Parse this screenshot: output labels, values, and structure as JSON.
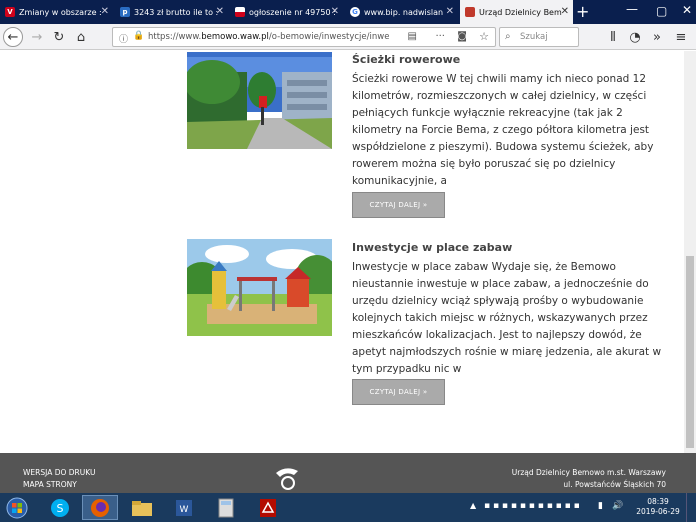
{
  "tabs": [
    {
      "title": "Zmiany w obszarze :",
      "fav": "V",
      "favcolor": "#d0021b"
    },
    {
      "title": "3243 zł brutto ile to :",
      "fav": "p",
      "favcolor": "#2a6cc2"
    },
    {
      "title": "ogłoszenie nr 49750 :",
      "fav": "",
      "favcolor": "#d0021b"
    },
    {
      "title": "www.bip. nadwislan",
      "fav": "G",
      "favcolor": "#ffffff"
    },
    {
      "title": "Urząd Dzielnicy Bem",
      "fav": "",
      "favcolor": "#c0392b"
    }
  ],
  "address": {
    "prefix": "https://www.",
    "domain": "bemowo.waw.pl",
    "path": "/o-bemowie/inwestycje/inwe"
  },
  "search_placeholder": "Szukaj",
  "articles": [
    {
      "title": "Ścieżki rowerowe",
      "text": "Ścieżki rowerowe W tej chwili mamy ich nieco ponad 12 kilometrów, rozmieszczonych w całej dzielnicy, w części pełniących funkcje wyłącznie rekreacyjne (tak jak 2 kilometry na Forcie Bema, z czego półtora kilometra jest współdzielone z pieszymi). Budowa systemu ścieżek, aby rowerem można się było poruszać się po dzielnicy komunikacyjnie, a",
      "button": "CZYTAJ DALEJ »"
    },
    {
      "title": "Inwestycje w place zabaw",
      "text": "Inwestycje w place zabaw Wydaje się, że Bemowo nieustannie inwestuje w place zabaw, a jednocześnie do urzędu dzielnicy wciąż spływają prośby o wybudowanie kolejnych takich miejsc w różnych, wskazywanych przez mieszkańców lokalizacjach. Jest to najlepszy dowód, że apetyt najmłodszych rośnie w miarę jedzenia, ale akurat w tym przypadku nic w",
      "button": "CZYTAJ DALEJ »"
    }
  ],
  "footer": {
    "print": "WERSJA DO DRUKU",
    "map": "MAPA STRONY",
    "org": "Urząd Dzielnicy Bemowo m.st. Warszawy",
    "address": "ul. Powstańców Śląskich 70"
  },
  "clock": {
    "time": "08:39",
    "date": "2019-06-29"
  }
}
